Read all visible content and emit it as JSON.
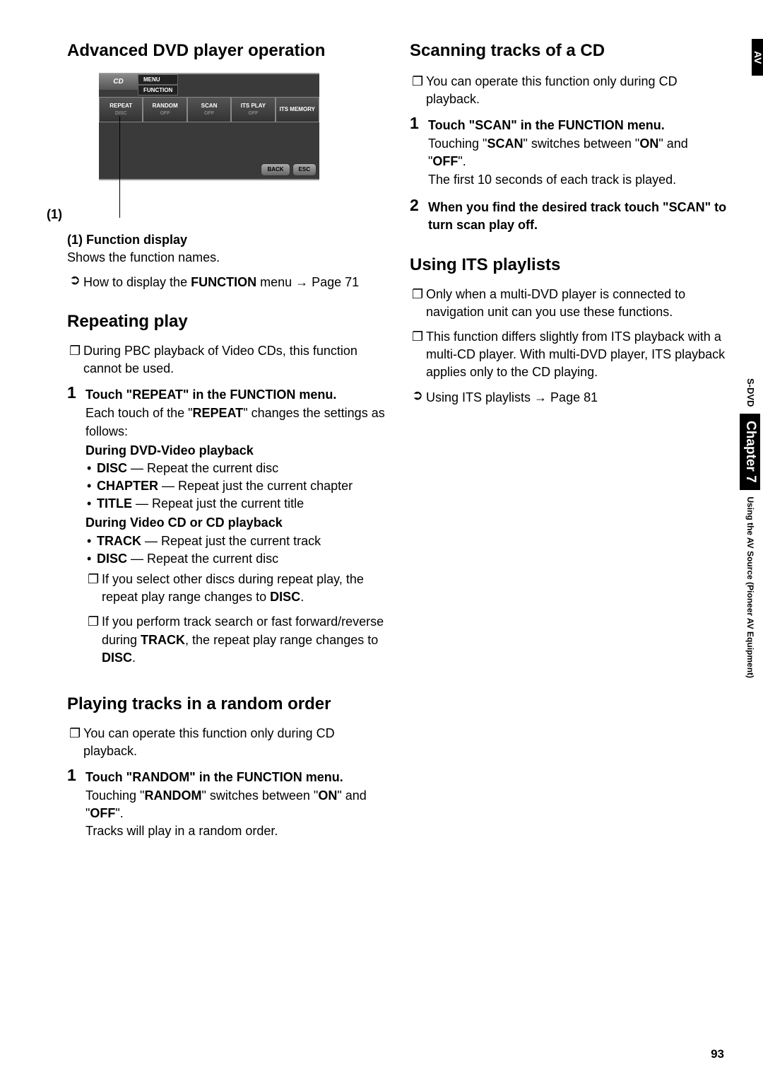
{
  "left": {
    "title": "Advanced DVD player operation",
    "figure": {
      "cd": "CD",
      "menu": "MENU",
      "func": "FUNCTION",
      "buttons": [
        {
          "t": "REPEAT",
          "s": "DISC"
        },
        {
          "t": "RANDOM",
          "s": "OFF"
        },
        {
          "t": "SCAN",
          "s": "OFF"
        },
        {
          "t": "ITS PLAY",
          "s": "OFF"
        },
        {
          "t": "ITS MEMORY",
          "s": ""
        }
      ],
      "back": "BACK",
      "esc": "ESC",
      "callout": "(1)"
    },
    "caption_head": "(1) Function display",
    "caption_text": "Shows the function names.",
    "crossref1_a": "How to display the ",
    "crossref1_b": "FUNCTION",
    "crossref1_c": " menu ",
    "crossref1_d": "Page 71",
    "h2": "Repeating play",
    "note1": "During PBC playback of Video CDs, this function cannot be used.",
    "step1_h_a": "Touch \"REPEAT\" in the FUNCTION menu.",
    "step1_p_a": "Each touch of the \"",
    "step1_p_b": "REPEAT",
    "step1_p_c": "\" changes the settings as follows:",
    "step1_sh1": "During DVD-Video playback",
    "step1_b1_a": "DISC",
    "step1_b1_b": " — Repeat the current disc",
    "step1_b2_a": "CHAPTER",
    "step1_b2_b": " — Repeat just the current chapter",
    "step1_b3_a": "TITLE",
    "step1_b3_b": " — Repeat just the current title",
    "step1_sh2": "During Video CD or CD playback",
    "step1_b4_a": "TRACK",
    "step1_b4_b": " — Repeat just the current track",
    "step1_b5_a": "DISC",
    "step1_b5_b": " — Repeat the current disc",
    "step1_n1_a": "If you select other discs during repeat play, the repeat play range changes to ",
    "step1_n1_b": "DISC",
    "step1_n1_c": ".",
    "step1_n2_a": "If you perform track search or fast forward/reverse during ",
    "step1_n2_b": "TRACK",
    "step1_n2_c": ", the repeat play range changes to ",
    "step1_n2_d": "DISC",
    "step1_n2_e": ".",
    "h3": "Playing tracks in a random order",
    "note2": "You can operate this function only during CD playback.",
    "step2_h": "Touch \"RANDOM\" in the FUNCTION menu.",
    "step2_p_a": "Touching \"",
    "step2_p_b": "RANDOM",
    "step2_p_c": "\" switches between \"",
    "step2_p_d": "ON",
    "step2_p_e": "\" and \"",
    "step2_p_f": "OFF",
    "step2_p_g": "\".",
    "step2_p2": "Tracks will play in a random order."
  },
  "right": {
    "title": "Scanning tracks of a CD",
    "note1": "You can operate this function only during CD playback.",
    "step1_h": "Touch \"SCAN\" in the FUNCTION menu.",
    "step1_p_a": "Touching \"",
    "step1_p_b": "SCAN",
    "step1_p_c": "\" switches between \"",
    "step1_p_d": "ON",
    "step1_p_e": "\" and \"",
    "step1_p_f": "OFF",
    "step1_p_g": "\".",
    "step1_p2": "The first 10 seconds of each track is played.",
    "step2_h": "When you find the desired track touch \"SCAN\" to turn scan play off.",
    "h2": "Using ITS playlists",
    "note2": "Only when a multi-DVD player is connected to navigation unit can you use these functions.",
    "note3": "This function differs slightly from ITS playback with a multi-CD player. With multi-DVD player, ITS playback applies only to the CD playing.",
    "cross_a": "Using ITS playlists ",
    "cross_b": " Page 81"
  },
  "side": {
    "av": "AV",
    "sdvd": "S-DVD",
    "chapter": "Chapter 7",
    "using": "Using the AV Source (Pioneer AV Equipment)"
  },
  "page": "93",
  "glyph_note": "❐",
  "glyph_semi": "➲",
  "glyph_arrow": "→"
}
